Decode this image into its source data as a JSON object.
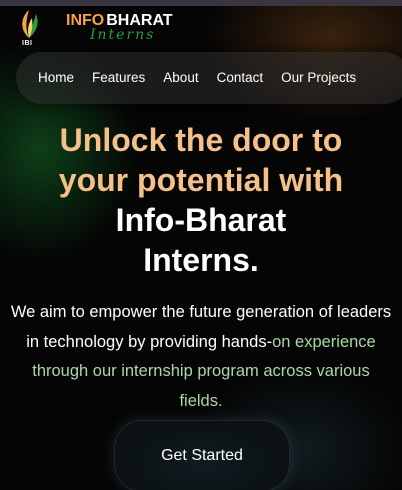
{
  "brand": {
    "word1": "INFO",
    "word2": "BHARAT",
    "subtitle": "Interns",
    "logo_caption": "IBI",
    "logo_icon": "flame-leaf-logo"
  },
  "nav": {
    "items": [
      {
        "label": "Home"
      },
      {
        "label": "Features"
      },
      {
        "label": "About"
      },
      {
        "label": "Contact"
      },
      {
        "label": "Our Projects"
      }
    ]
  },
  "hero": {
    "line1": "Unlock the door to",
    "line2": "your potential with",
    "line3": "Info-Bharat",
    "line4": "Interns."
  },
  "description": {
    "white_part": "We aim to empower the future generation of leaders in technology by providing hands-",
    "green_part": "on experience through our internship program across various fields."
  },
  "cta": {
    "label": "Get Started"
  },
  "colors": {
    "accent_orange": "#f5c08a",
    "brand_green": "#2e9e3b",
    "text_green": "#a8d9a4",
    "background": "#050505"
  }
}
